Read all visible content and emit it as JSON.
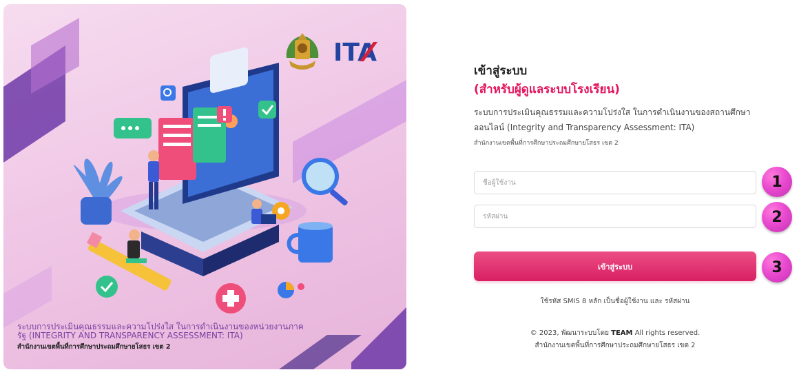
{
  "hero": {
    "logo_text": "ITA",
    "title": "ระบบการประเมินคุณธรรมและความโปร่งใส ในการดำเนินงานของหน่วยงานภาครัฐ (INTEGRITY AND TRANSPARENCY ASSESSMENT: ITA)",
    "office": "สำนักงานเขตพื้นที่การศึกษาประถมศึกษายโสธร เขต 2"
  },
  "form": {
    "title": "เข้าสู่ระบบ",
    "subtitle": "(สำหรับผู้ดูแลระบบโรงเรียน)",
    "description": "ระบบการประเมินคุณธรรมและความโปร่งใส ในการดำเนินงานของสถานศึกษาออนไลน์ (Integrity and Transparency Assessment: ITA)",
    "office": "สำนักงานเขตพื้นที่การศึกษาประถมศึกษายโสธร เขต 2",
    "username_placeholder": "ชื่อผู้ใช้งาน",
    "password_placeholder": "รหัสผ่าน",
    "login_label": "เข้าสู่ระบบ",
    "hint": "ใช้รหัส SMIS 8 หลัก เป็นชื่อผู้ใช้งาน และ รหัสผ่าน"
  },
  "steps": [
    "1",
    "2",
    "3"
  ],
  "footer": {
    "copyright_prefix": "© 2023, พัฒนาระบบโดย",
    "team": "TEAM",
    "copyright_suffix": "All rights reserved.",
    "office": "สำนักงานเขตพื้นที่การศึกษาประถมศึกษายโสธร เขต 2"
  },
  "colors": {
    "accent": "#e3135c",
    "button": "#d81f63",
    "step_badge": "#e94ad0",
    "hero_title": "#7b3fa0"
  },
  "icons": [
    "seal-logo-icon",
    "ita-logo-icon",
    "laptop-illustration-icon",
    "search-icon",
    "check-icon",
    "alert-icon",
    "chat-icon",
    "plant-icon",
    "magnifier-icon",
    "gear-icon",
    "mug-icon",
    "pencil-icon",
    "plus-icon",
    "pie-icon"
  ]
}
